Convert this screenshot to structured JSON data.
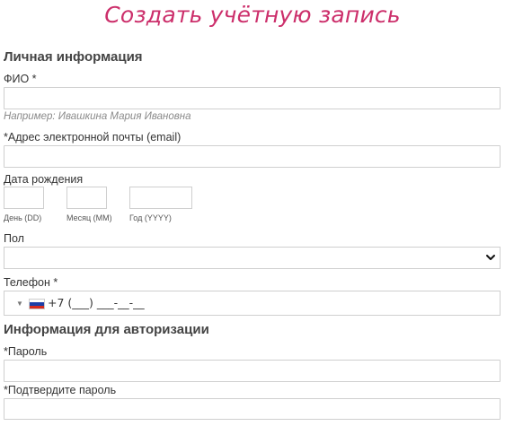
{
  "title": "Создать учётную запись",
  "personal": {
    "section_title": "Личная информация",
    "fio_label": "ФИО *",
    "fio_value": "",
    "fio_hint": "Например: Ивашкина Мария Ивановна",
    "email_label": "*Адрес электронной почты (email)",
    "email_value": "",
    "dob_label": "Дата рождения",
    "dob": {
      "day_label": "День (DD)",
      "month_label": "Месяц (MM)",
      "year_label": "Год (YYYY)",
      "day_value": "",
      "month_value": "",
      "year_value": ""
    },
    "gender_label": "Пол",
    "gender_selected": "",
    "phone_label": "Телефон *",
    "phone_value": "+7 (___) ___-__-__",
    "phone_country_icon": "russia-flag-icon"
  },
  "auth": {
    "section_title": "Информация для авторизации",
    "password_label": "*Пароль",
    "password_value": "",
    "confirm_label": "*Подтвердите пароль",
    "confirm_value": ""
  },
  "colors": {
    "title": "#cc2f6b",
    "border": "#cfcfcf",
    "hint": "#8a8a8a"
  }
}
